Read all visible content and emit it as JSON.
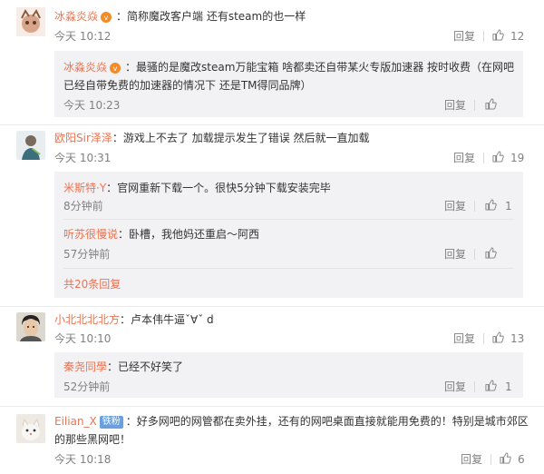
{
  "comments": [
    {
      "user": "冰淼炎焱",
      "text": "：简称魔改客户端 还有steam的也一样",
      "time": "今天 10:12",
      "reply": "回复",
      "likes": "12"
    },
    {
      "user": "欧阳Sir泽泽",
      "text": "：游戏上不去了 加载提示发生了错误 然后就一直加载",
      "time": "今天 10:31",
      "reply": "回复",
      "likes": "19"
    },
    {
      "user": "小北北北北方",
      "text": "：卢本伟牛逼ˇ∀ˇ d",
      "time": "今天 10:10",
      "reply": "回复",
      "likes": "13"
    },
    {
      "user": "Eilian_X",
      "badge": "铁粉",
      "text": "：好多网吧的网管都在卖外挂，还有的网吧桌面直接就能用免费的！特别是城市郊区",
      "text2": "的那些黑网吧！",
      "time": "今天 10:18",
      "reply": "回复",
      "likes": "6"
    }
  ],
  "sub_replies": [
    {
      "user": "冰淼炎焱",
      "text": "：最骚的是魔改steam万能宝箱 啥都卖还自带某火专版加速器 按时收费（在网吧",
      "text2": "已经自带免费的加速器的情况下 还是TM得同品牌）",
      "time": "今天 10:23",
      "reply": "回复"
    },
    {
      "user": "米斯特·Y",
      "text": "：官网重新下载一个。很快5分钟下载安装完毕",
      "time": "8分钟前",
      "reply": "回复",
      "likes": "1"
    },
    {
      "user": "听苏很慢说",
      "text": "：卧槽，我他妈还重启～阿西",
      "time": "57分钟前",
      "reply": "回复"
    },
    {
      "user": "秦尧同學",
      "text": "：已经不好笑了",
      "time": "52分钟前",
      "reply": "回复",
      "likes": "1"
    }
  ],
  "more_replies": "共20条回复"
}
